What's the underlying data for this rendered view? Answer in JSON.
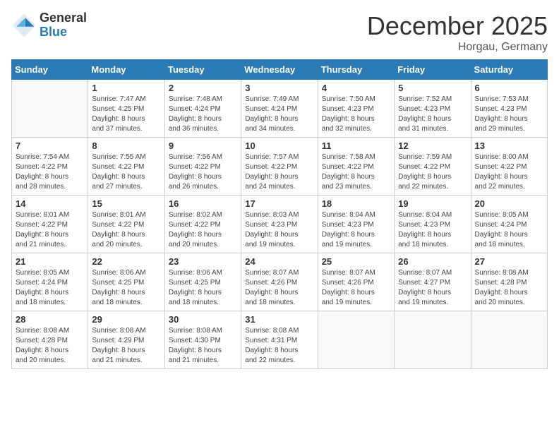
{
  "header": {
    "logo_general": "General",
    "logo_blue": "Blue",
    "month_title": "December 2025",
    "location": "Horgau, Germany"
  },
  "days_of_week": [
    "Sunday",
    "Monday",
    "Tuesday",
    "Wednesday",
    "Thursday",
    "Friday",
    "Saturday"
  ],
  "weeks": [
    [
      {
        "day": "",
        "info": ""
      },
      {
        "day": "1",
        "info": "Sunrise: 7:47 AM\nSunset: 4:25 PM\nDaylight: 8 hours\nand 37 minutes."
      },
      {
        "day": "2",
        "info": "Sunrise: 7:48 AM\nSunset: 4:24 PM\nDaylight: 8 hours\nand 36 minutes."
      },
      {
        "day": "3",
        "info": "Sunrise: 7:49 AM\nSunset: 4:24 PM\nDaylight: 8 hours\nand 34 minutes."
      },
      {
        "day": "4",
        "info": "Sunrise: 7:50 AM\nSunset: 4:23 PM\nDaylight: 8 hours\nand 32 minutes."
      },
      {
        "day": "5",
        "info": "Sunrise: 7:52 AM\nSunset: 4:23 PM\nDaylight: 8 hours\nand 31 minutes."
      },
      {
        "day": "6",
        "info": "Sunrise: 7:53 AM\nSunset: 4:23 PM\nDaylight: 8 hours\nand 29 minutes."
      }
    ],
    [
      {
        "day": "7",
        "info": "Sunrise: 7:54 AM\nSunset: 4:22 PM\nDaylight: 8 hours\nand 28 minutes."
      },
      {
        "day": "8",
        "info": "Sunrise: 7:55 AM\nSunset: 4:22 PM\nDaylight: 8 hours\nand 27 minutes."
      },
      {
        "day": "9",
        "info": "Sunrise: 7:56 AM\nSunset: 4:22 PM\nDaylight: 8 hours\nand 26 minutes."
      },
      {
        "day": "10",
        "info": "Sunrise: 7:57 AM\nSunset: 4:22 PM\nDaylight: 8 hours\nand 24 minutes."
      },
      {
        "day": "11",
        "info": "Sunrise: 7:58 AM\nSunset: 4:22 PM\nDaylight: 8 hours\nand 23 minutes."
      },
      {
        "day": "12",
        "info": "Sunrise: 7:59 AM\nSunset: 4:22 PM\nDaylight: 8 hours\nand 22 minutes."
      },
      {
        "day": "13",
        "info": "Sunrise: 8:00 AM\nSunset: 4:22 PM\nDaylight: 8 hours\nand 22 minutes."
      }
    ],
    [
      {
        "day": "14",
        "info": "Sunrise: 8:01 AM\nSunset: 4:22 PM\nDaylight: 8 hours\nand 21 minutes."
      },
      {
        "day": "15",
        "info": "Sunrise: 8:01 AM\nSunset: 4:22 PM\nDaylight: 8 hours\nand 20 minutes."
      },
      {
        "day": "16",
        "info": "Sunrise: 8:02 AM\nSunset: 4:22 PM\nDaylight: 8 hours\nand 20 minutes."
      },
      {
        "day": "17",
        "info": "Sunrise: 8:03 AM\nSunset: 4:23 PM\nDaylight: 8 hours\nand 19 minutes."
      },
      {
        "day": "18",
        "info": "Sunrise: 8:04 AM\nSunset: 4:23 PM\nDaylight: 8 hours\nand 19 minutes."
      },
      {
        "day": "19",
        "info": "Sunrise: 8:04 AM\nSunset: 4:23 PM\nDaylight: 8 hours\nand 18 minutes."
      },
      {
        "day": "20",
        "info": "Sunrise: 8:05 AM\nSunset: 4:24 PM\nDaylight: 8 hours\nand 18 minutes."
      }
    ],
    [
      {
        "day": "21",
        "info": "Sunrise: 8:05 AM\nSunset: 4:24 PM\nDaylight: 8 hours\nand 18 minutes."
      },
      {
        "day": "22",
        "info": "Sunrise: 8:06 AM\nSunset: 4:25 PM\nDaylight: 8 hours\nand 18 minutes."
      },
      {
        "day": "23",
        "info": "Sunrise: 8:06 AM\nSunset: 4:25 PM\nDaylight: 8 hours\nand 18 minutes."
      },
      {
        "day": "24",
        "info": "Sunrise: 8:07 AM\nSunset: 4:26 PM\nDaylight: 8 hours\nand 18 minutes."
      },
      {
        "day": "25",
        "info": "Sunrise: 8:07 AM\nSunset: 4:26 PM\nDaylight: 8 hours\nand 19 minutes."
      },
      {
        "day": "26",
        "info": "Sunrise: 8:07 AM\nSunset: 4:27 PM\nDaylight: 8 hours\nand 19 minutes."
      },
      {
        "day": "27",
        "info": "Sunrise: 8:08 AM\nSunset: 4:28 PM\nDaylight: 8 hours\nand 20 minutes."
      }
    ],
    [
      {
        "day": "28",
        "info": "Sunrise: 8:08 AM\nSunset: 4:28 PM\nDaylight: 8 hours\nand 20 minutes."
      },
      {
        "day": "29",
        "info": "Sunrise: 8:08 AM\nSunset: 4:29 PM\nDaylight: 8 hours\nand 21 minutes."
      },
      {
        "day": "30",
        "info": "Sunrise: 8:08 AM\nSunset: 4:30 PM\nDaylight: 8 hours\nand 21 minutes."
      },
      {
        "day": "31",
        "info": "Sunrise: 8:08 AM\nSunset: 4:31 PM\nDaylight: 8 hours\nand 22 minutes."
      },
      {
        "day": "",
        "info": ""
      },
      {
        "day": "",
        "info": ""
      },
      {
        "day": "",
        "info": ""
      }
    ]
  ]
}
